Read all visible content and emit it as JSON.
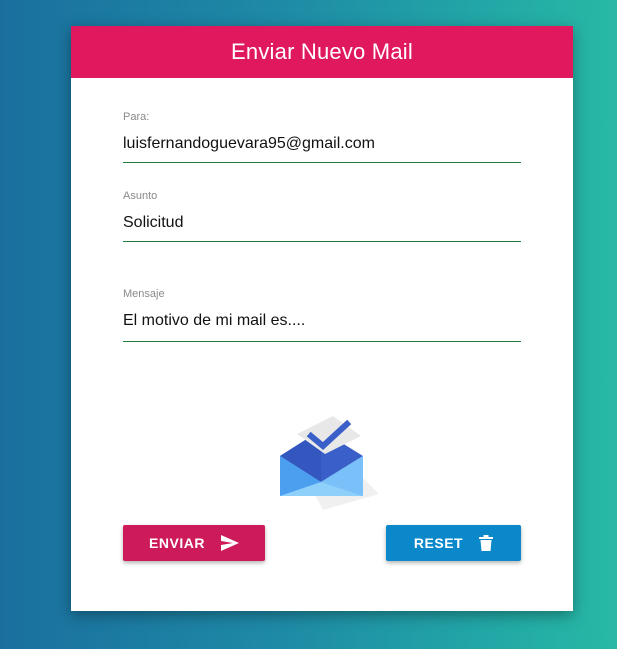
{
  "header": {
    "title": "Enviar Nuevo Mail"
  },
  "form": {
    "para": {
      "label": "Para:",
      "value": "luisfernandoguevara95@gmail.com"
    },
    "asunto": {
      "label": "Asunto",
      "value": "Solicitud"
    },
    "mensaje": {
      "label": "Mensaje",
      "value": "El motivo de mi mail es...."
    }
  },
  "logo": {
    "icon": "inbox-envelope-check-icon"
  },
  "buttons": {
    "enviar": {
      "label": "ENVIAR",
      "icon": "send-icon",
      "color": "#cc1a5a"
    },
    "reset": {
      "label": "RESET",
      "icon": "trash-icon",
      "color": "#0a88c9"
    }
  },
  "colors": {
    "header": "#e0185e",
    "underline": "#1f7a3a",
    "background_start": "#1a6f9e",
    "background_end": "#28b9a5"
  }
}
